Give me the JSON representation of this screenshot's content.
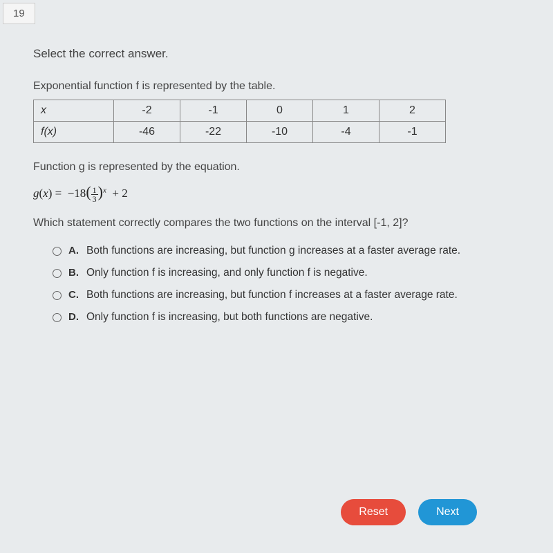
{
  "question_number": "19",
  "instruction": "Select the correct answer.",
  "prompt_table": "Exponential function f is represented by the table.",
  "table": {
    "row1_label": "x",
    "row1": [
      "-2",
      "-1",
      "0",
      "1",
      "2"
    ],
    "row2_label": "f(x)",
    "row2": [
      "-46",
      "-22",
      "-10",
      "-4",
      "-1"
    ]
  },
  "prompt_g": "Function g is represented by the equation.",
  "equation_text": "g(x) = -18(1/3)^x + 2",
  "question_text": "Which statement correctly compares the two functions on the interval [-1, 2]?",
  "options": {
    "a": {
      "letter": "A.",
      "text": "Both functions are increasing, but function g increases at a faster average rate."
    },
    "b": {
      "letter": "B.",
      "text": "Only function f is increasing, and only function f is negative."
    },
    "c": {
      "letter": "C.",
      "text": "Both functions are increasing, but function f increases at a faster average rate."
    },
    "d": {
      "letter": "D.",
      "text": "Only function f is increasing, but both functions are negative."
    }
  },
  "buttons": {
    "reset": "Reset",
    "next": "Next"
  }
}
